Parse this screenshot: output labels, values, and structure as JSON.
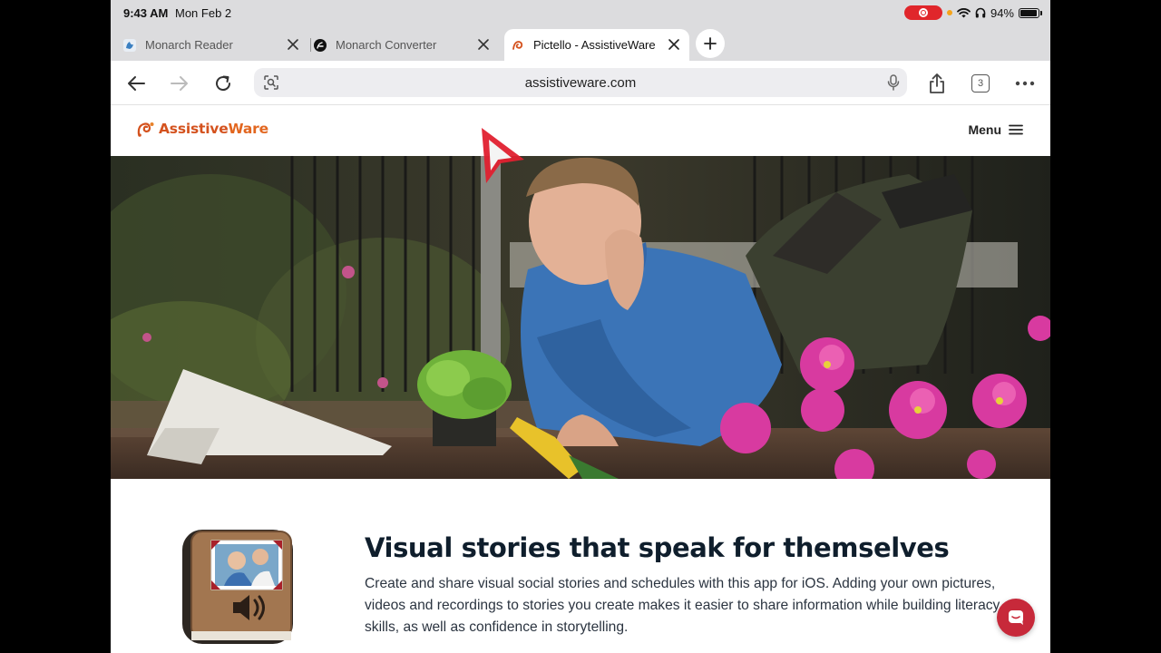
{
  "status_bar": {
    "time": "9:43 AM",
    "date": "Mon Feb 2",
    "battery": "94%",
    "battery_level": 0.94
  },
  "tabs": [
    {
      "label": "Monarch Reader",
      "icon": "monarch-reader-icon",
      "active": false
    },
    {
      "label": "Monarch Converter",
      "icon": "monarch-converter-icon",
      "active": false
    },
    {
      "label": "Pictello - AssistiveWare",
      "icon": "assistiveware-favicon",
      "active": true
    }
  ],
  "toolbar": {
    "url": "assistiveware.com",
    "tab_count": "3"
  },
  "site": {
    "logo_part1": "Assistive",
    "logo_part2": "Ware",
    "menu_label": "Menu"
  },
  "content": {
    "headline": "Visual stories that speak for themselves",
    "description": "Create and share visual social stories and schedules with this app for iOS. Adding your own pictures, videos and recordings to stories you create makes it easier to share information while building literacy skills, as well as confidence in storytelling."
  },
  "colors": {
    "brand": "#d4521e",
    "chat": "#c7293a",
    "pointer": "#e0202f"
  }
}
